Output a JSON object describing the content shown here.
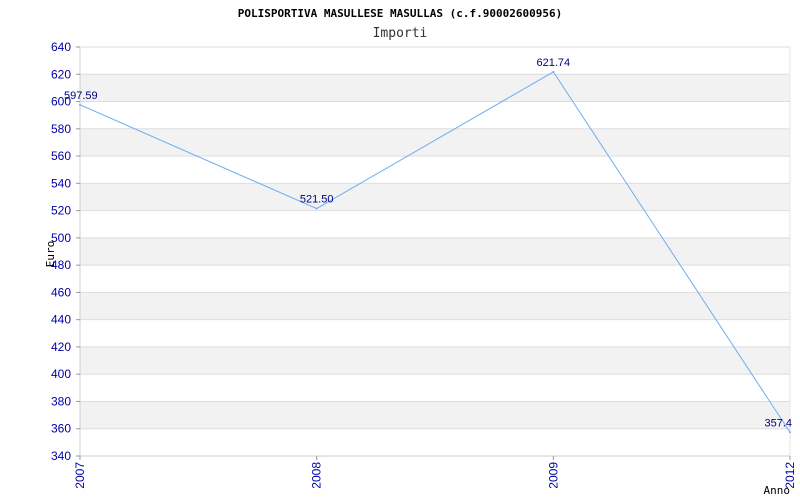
{
  "chart_data": {
    "type": "line",
    "title": "POLISPORTIVA MASULLESE MASULLAS (c.f.90002600956)",
    "subtitle": "Importi",
    "xlabel": "Anno",
    "ylabel": "Euro",
    "categories": [
      "2007",
      "2008",
      "2009",
      "2012"
    ],
    "value_labels": [
      "597.59",
      "521.50",
      "621.74",
      "357.4"
    ],
    "series": [
      {
        "values": [
          597.59,
          521.5,
          621.74,
          357.4
        ]
      }
    ],
    "ylim": [
      340,
      640
    ],
    "yticks": [
      "340",
      "360",
      "380",
      "400",
      "420",
      "440",
      "460",
      "480",
      "500",
      "520",
      "540",
      "560",
      "580",
      "600",
      "620",
      "640"
    ],
    "grid": true,
    "colors": {
      "line": "#6aaef0",
      "band": "#f2f2f2",
      "tick_text": "#0000aa",
      "data_label": "#000080"
    }
  }
}
